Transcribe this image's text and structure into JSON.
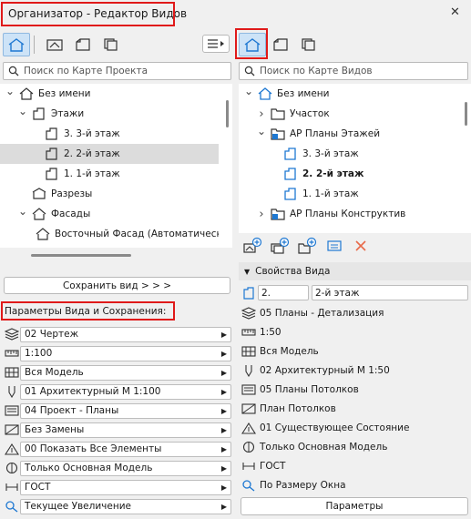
{
  "window": {
    "title": "Организатор - Редактор Видов",
    "close_glyph": "✕"
  },
  "left": {
    "search_placeholder": "Поиск по Карте Проекта",
    "tree": [
      {
        "label": "Без имени",
        "level": 0,
        "icon": "project-icon",
        "chev": "down"
      },
      {
        "label": "Этажи",
        "level": 1,
        "icon": "stories-icon",
        "chev": "down"
      },
      {
        "label": "3. 3-й этаж",
        "level": 2,
        "icon": "story-icon",
        "chev": ""
      },
      {
        "label": "2. 2-й этаж",
        "level": 2,
        "icon": "story-icon",
        "chev": "",
        "selected": true
      },
      {
        "label": "1. 1-й этаж",
        "level": 2,
        "icon": "story-icon",
        "chev": ""
      },
      {
        "label": "Разрезы",
        "level": 1,
        "icon": "section-icon",
        "chev": ""
      },
      {
        "label": "Фасады",
        "level": 1,
        "icon": "elevation-icon",
        "chev": "down"
      },
      {
        "label": "Восточный Фасад (Автоматическ",
        "level": 2,
        "icon": "elevation-icon",
        "chev": ""
      }
    ],
    "save_view_label": "Сохранить вид > > >",
    "params_title": "Параметры Вида и Сохранения:",
    "params": [
      {
        "icon": "layers-icon",
        "value": "02 Чертеж"
      },
      {
        "icon": "scale-icon",
        "value": "1:100"
      },
      {
        "icon": "structure-icon",
        "value": "Вся Модель"
      },
      {
        "icon": "pen-icon",
        "value": "01 Архитектурный М 1:100"
      },
      {
        "icon": "mvo-icon",
        "value": "04 Проект - Планы"
      },
      {
        "icon": "override-icon",
        "value": "Без Замены"
      },
      {
        "icon": "renovation-icon",
        "value": "00 Показать Все Элементы"
      },
      {
        "icon": "partial-structure-icon",
        "value": "Только Основная Модель"
      },
      {
        "icon": "dimension-icon",
        "value": "ГОСТ"
      },
      {
        "icon": "zoom-icon",
        "value": "Текущее Увеличение"
      }
    ]
  },
  "right": {
    "search_placeholder": "Поиск по Карте Видов",
    "tree": [
      {
        "label": "Без имени",
        "level": 0,
        "icon": "project-icon",
        "chev": "down"
      },
      {
        "label": "Участок",
        "level": 1,
        "icon": "folder-icon",
        "chev": "right"
      },
      {
        "label": "АР Планы Этажей",
        "level": 1,
        "icon": "folder-view-icon",
        "chev": "down"
      },
      {
        "label": "3. 3-й этаж",
        "level": 2,
        "icon": "story-icon",
        "chev": ""
      },
      {
        "label": "2. 2-й этаж",
        "level": 2,
        "icon": "story-icon",
        "chev": "",
        "bold": true
      },
      {
        "label": "1. 1-й этаж",
        "level": 2,
        "icon": "story-icon",
        "chev": ""
      },
      {
        "label": "АР Планы Конструктив",
        "level": 1,
        "icon": "folder-view-icon",
        "chev": "right"
      }
    ],
    "properties_title": "Свойства Вида",
    "id_value": "2.",
    "name_value": "2-й этаж",
    "props": [
      {
        "icon": "layers-icon",
        "value": "05 Планы - Детализация"
      },
      {
        "icon": "scale-icon",
        "value": "1:50"
      },
      {
        "icon": "structure-icon",
        "value": "Вся Модель"
      },
      {
        "icon": "pen-icon",
        "value": "02 Архитектурный М 1:50"
      },
      {
        "icon": "mvo-icon",
        "value": "05 Планы Потолков"
      },
      {
        "icon": "override-icon",
        "value": "План Потолков"
      },
      {
        "icon": "renovation-icon",
        "value": "01 Существующее Состояние"
      },
      {
        "icon": "partial-structure-icon",
        "value": "Только Основная Модель"
      },
      {
        "icon": "dimension-icon",
        "value": "ГОСТ"
      },
      {
        "icon": "zoom-icon",
        "value": "По Размеру Окна"
      }
    ],
    "params_button": "Параметры"
  },
  "colors": {
    "accent": "#1e78d2",
    "highlight": "#e01a1a",
    "selected_bg": "#dcdcdc"
  }
}
